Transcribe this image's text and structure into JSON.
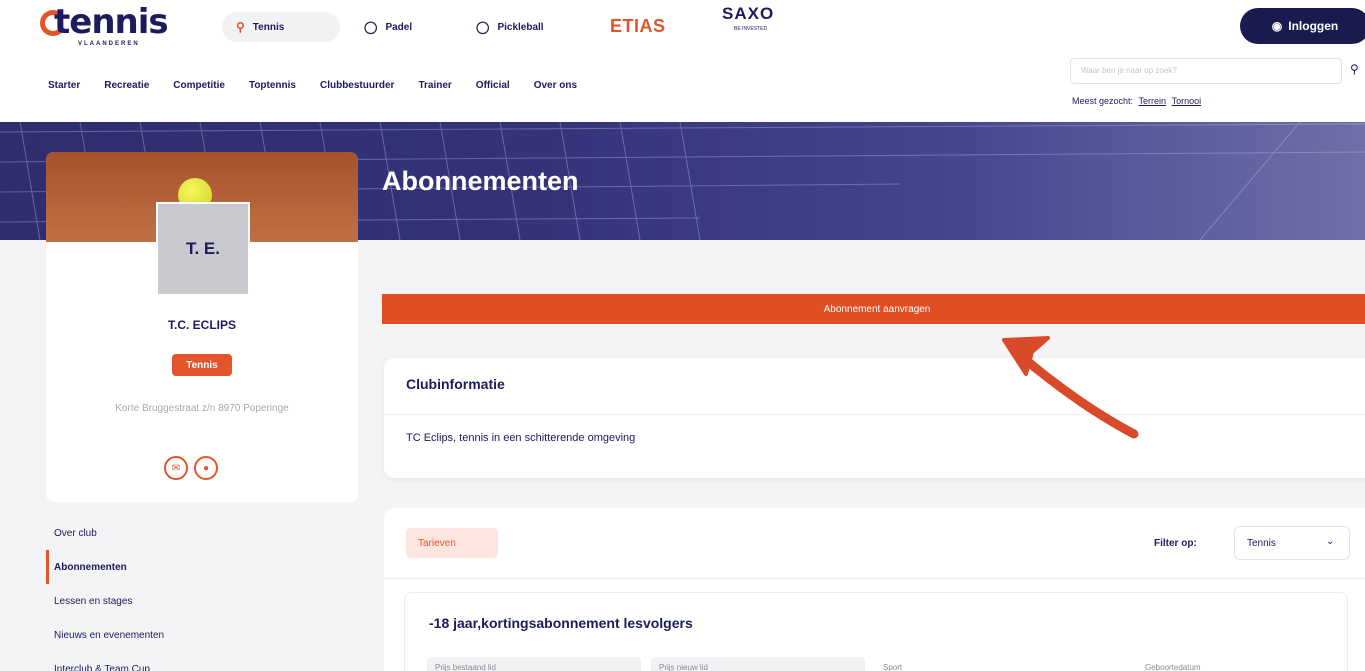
{
  "header": {
    "logo_text": "tennis",
    "logo_sub": "VLAANDEREN",
    "sports": [
      {
        "label": "Tennis",
        "icon": "racket-icon"
      },
      {
        "label": "Padel",
        "icon": "padel-icon"
      },
      {
        "label": "Pickleball",
        "icon": "pickleball-icon"
      }
    ],
    "sponsor1": "ETIAS",
    "sponsor2": "SAXO",
    "sponsor2_sub": "BE INVESTED",
    "login_label": "Inloggen",
    "nav": [
      "Starter",
      "Recreatie",
      "Competitie",
      "Toptennis",
      "Clubbestuurder",
      "Trainer",
      "Official",
      "Over ons"
    ],
    "search_placeholder": "Waar ben je naar op zoek?",
    "popular_label": "Meest gezocht:",
    "popular_links": [
      "Terrein",
      "Tornooi"
    ]
  },
  "hero": {
    "title": "Abonnementen"
  },
  "club": {
    "initials": "T. E.",
    "name": "T.C. ECLIPS",
    "sport_badge": "Tennis",
    "address": "Korte Bruggestraat z/n 8970 Poperinge"
  },
  "side_menu": [
    {
      "label": "Over club",
      "active": false
    },
    {
      "label": "Abonnementen",
      "active": true
    },
    {
      "label": "Lessen en stages",
      "active": false
    },
    {
      "label": "Nieuws en evenementen",
      "active": false
    },
    {
      "label": "Interclub & Team Cup",
      "active": false
    }
  ],
  "main": {
    "cta_label": "Abonnement aanvragen",
    "info_title": "Clubinformatie",
    "info_text": "TC Eclips, tennis in een schitterende omgeving",
    "rates_tag": "Tarieven",
    "filter_label": "Filter op:",
    "filter_value": "Tennis",
    "subscription_title": "-18 jaar,kortingsabonnement lesvolgers",
    "columns": [
      "Prijs bestaand lid",
      "Prijs nieuw lid",
      "Sport",
      "Geboortedatum"
    ]
  },
  "colors": {
    "accent": "#e4542b",
    "navy": "#1b1b5e"
  }
}
